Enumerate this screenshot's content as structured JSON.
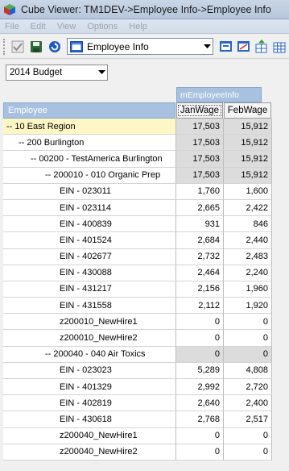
{
  "window": {
    "title": "Cube Viewer: TM1DEV->Employee Info->Employee Info"
  },
  "menu": {
    "items": [
      "File",
      "Edit",
      "View",
      "Options",
      "Help"
    ]
  },
  "toolbar": {
    "view_name": "Employee Info"
  },
  "title_dimension": {
    "selected": "2014 Budget"
  },
  "grid": {
    "column_dimension": "mEmployeeInfo",
    "row_dimension": "Employee",
    "columns": [
      "JanWage",
      "FebWage"
    ],
    "rows": [
      {
        "label": "-- 10 East Region",
        "indent": 0,
        "jan": "17,503",
        "feb": "15,912",
        "consolidated": true,
        "highlight": true
      },
      {
        "label": "-- 200 Burlington",
        "indent": 1,
        "jan": "17,503",
        "feb": "15,912",
        "consolidated": true
      },
      {
        "label": "-- 00200 - TestAmerica Burlington",
        "indent": 2,
        "jan": "17,503",
        "feb": "15,912",
        "consolidated": true
      },
      {
        "label": "-- 200010 - 010 Organic Prep",
        "indent": 3,
        "jan": "17,503",
        "feb": "15,912",
        "consolidated": true
      },
      {
        "label": "EIN - 023011",
        "indent": 4,
        "jan": "1,760",
        "feb": "1,600",
        "consolidated": false
      },
      {
        "label": "EIN - 023114",
        "indent": 4,
        "jan": "2,665",
        "feb": "2,422",
        "consolidated": false
      },
      {
        "label": "EIN - 400839",
        "indent": 4,
        "jan": "931",
        "feb": "846",
        "consolidated": false
      },
      {
        "label": "EIN - 401524",
        "indent": 4,
        "jan": "2,684",
        "feb": "2,440",
        "consolidated": false
      },
      {
        "label": "EIN - 402677",
        "indent": 4,
        "jan": "2,732",
        "feb": "2,483",
        "consolidated": false
      },
      {
        "label": "EIN - 430088",
        "indent": 4,
        "jan": "2,464",
        "feb": "2,240",
        "consolidated": false
      },
      {
        "label": "EIN - 431217",
        "indent": 4,
        "jan": "2,156",
        "feb": "1,960",
        "consolidated": false
      },
      {
        "label": "EIN - 431558",
        "indent": 4,
        "jan": "2,112",
        "feb": "1,920",
        "consolidated": false
      },
      {
        "label": "z200010_NewHire1",
        "indent": 4,
        "jan": "0",
        "feb": "0",
        "consolidated": false
      },
      {
        "label": "z200010_NewHire2",
        "indent": 4,
        "jan": "0",
        "feb": "0",
        "consolidated": false
      },
      {
        "label": "-- 200040 - 040 Air Toxics",
        "indent": 3,
        "jan": "0",
        "feb": "0",
        "consolidated": true
      },
      {
        "label": "EIN - 023023",
        "indent": 4,
        "jan": "5,289",
        "feb": "4,808",
        "consolidated": false
      },
      {
        "label": "EIN - 401329",
        "indent": 4,
        "jan": "2,992",
        "feb": "2,720",
        "consolidated": false
      },
      {
        "label": "EIN - 402819",
        "indent": 4,
        "jan": "2,640",
        "feb": "2,400",
        "consolidated": false
      },
      {
        "label": "EIN - 430618",
        "indent": 4,
        "jan": "2,768",
        "feb": "2,517",
        "consolidated": false
      },
      {
        "label": "z200040_NewHire1",
        "indent": 4,
        "jan": "0",
        "feb": "0",
        "consolidated": false
      },
      {
        "label": "z200040_NewHire2",
        "indent": 4,
        "jan": "0",
        "feb": "0",
        "consolidated": false
      }
    ]
  }
}
